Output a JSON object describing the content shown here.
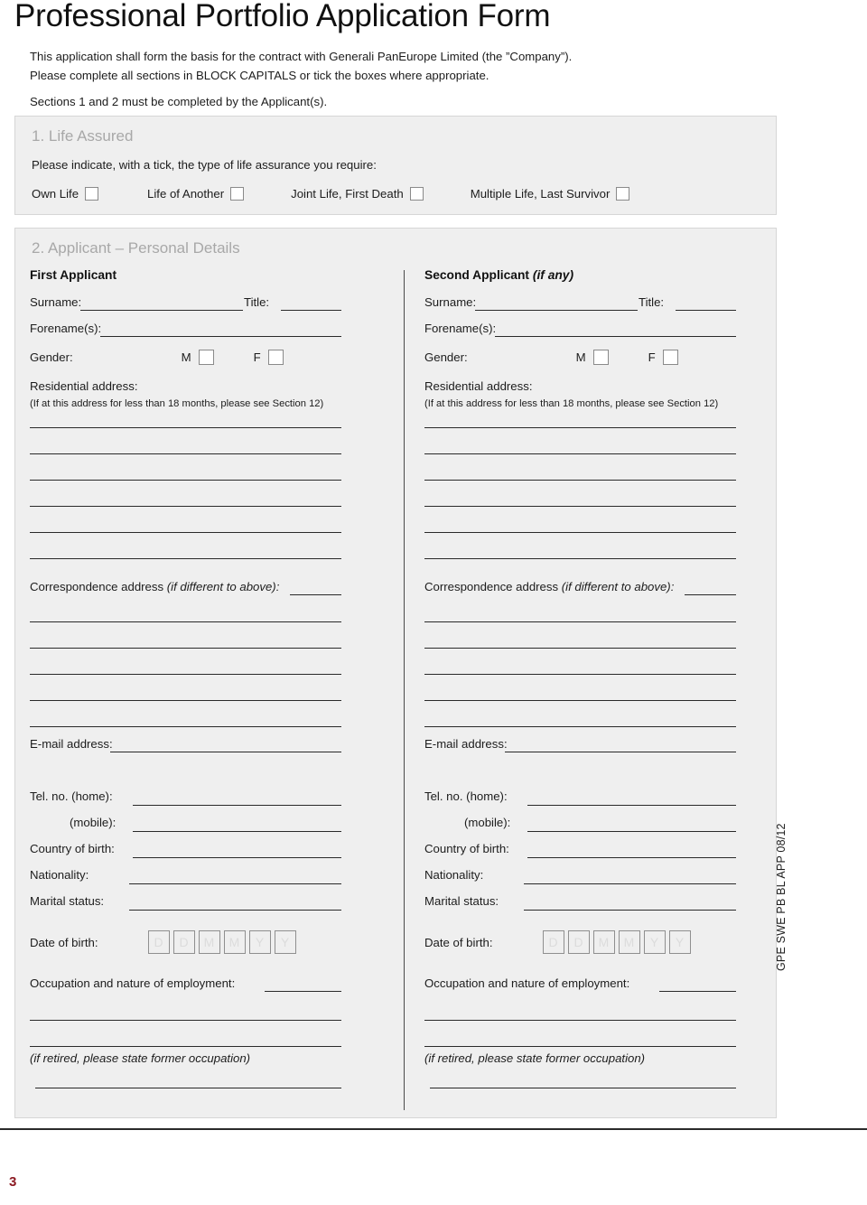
{
  "document": {
    "title": "Professional Portfolio Application Form",
    "intro_lines": [
      "This application shall form the basis for the contract with Generali PanEurope Limited (the ”Company”).",
      "Please complete all sections in BLOCK CAPITALS or tick the boxes where appropriate.",
      "Sections 1 and 2 must be completed by the Applicant(s)."
    ],
    "page_number": "3",
    "doc_code": "GPE SWE PB BL APP 08/12",
    "accent_color": "#8c1a22",
    "section_heading_color": "#a8a8a8",
    "section_background": "#efefef"
  },
  "section1": {
    "heading": "1. Life Assured",
    "instruction": "Please indicate, with a tick, the type of life assurance you require:",
    "options": [
      {
        "label": "Own Life"
      },
      {
        "label": "Life of Another"
      },
      {
        "label": "Joint Life, First Death"
      },
      {
        "label": "Multiple Life, Last Survivor"
      }
    ]
  },
  "section2": {
    "heading": "2. Applicant – Personal Details",
    "columns": [
      {
        "title_main": "First Applicant",
        "title_italic": ""
      },
      {
        "title_main": "Second Applicant ",
        "title_italic": "(if any)"
      }
    ],
    "labels": {
      "surname": "Surname:",
      "title": "Title:",
      "forenames": "Forename(s):",
      "gender": "Gender:",
      "gender_male": "M",
      "gender_female": "F",
      "residential_address": "Residential address:",
      "residential_note": "(If at this address for less than 18 months, please see Section 12)",
      "correspondence_address": "Correspondence address ",
      "correspondence_italic": "(if different to above):",
      "email": "E-mail address:",
      "tel_home": "Tel. no.   (home):",
      "tel_mobile": "(mobile):",
      "country_of_birth": "Country of birth:",
      "nationality": "Nationality:",
      "marital_status": "Marital status:",
      "date_of_birth": "Date of birth:",
      "occupation": "Occupation and nature of employment:",
      "retired_note": "(if retired, please state former occupation)"
    },
    "dob_cells": [
      "D",
      "D",
      "M",
      "M",
      "Y",
      "Y"
    ],
    "residential_line_count": 6,
    "correspondence_line_count": 5
  }
}
